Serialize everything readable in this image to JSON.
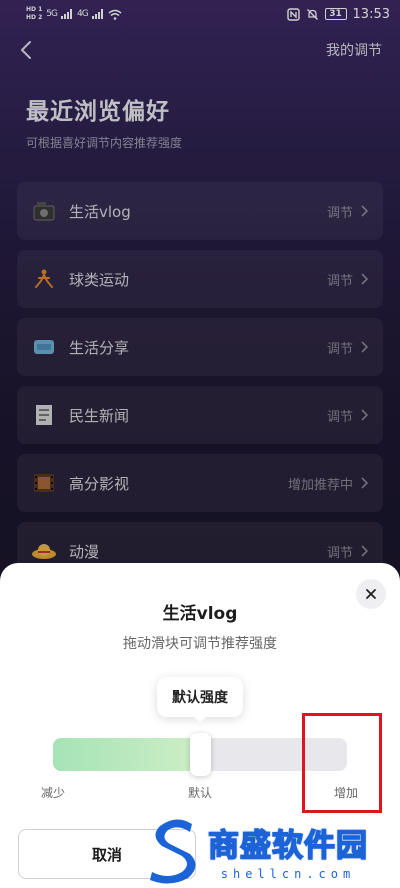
{
  "status_bar": {
    "hd1": "HD 1",
    "hd2": "HD 2",
    "signal1": "5G",
    "signal2": "4G",
    "battery": "31",
    "time": "13:53"
  },
  "nav": {
    "right_label": "我的调节"
  },
  "header": {
    "title": "最近浏览偏好",
    "subtitle": "可根据喜好调节内容推荐强度"
  },
  "preferences": [
    {
      "label": "生活vlog",
      "action": "调节",
      "icon": "camera-icon"
    },
    {
      "label": "球类运动",
      "action": "调节",
      "icon": "sports-icon"
    },
    {
      "label": "生活分享",
      "action": "调节",
      "icon": "sofa-icon"
    },
    {
      "label": "民生新闻",
      "action": "调节",
      "icon": "news-icon"
    },
    {
      "label": "高分影视",
      "action": "增加推荐中",
      "icon": "film-icon"
    },
    {
      "label": "动漫",
      "action": "调节",
      "icon": "hat-icon"
    }
  ],
  "sheet": {
    "title": "生活vlog",
    "subtitle": "拖动滑块可调节推荐强度",
    "tooltip": "默认强度",
    "scale_min": "减少",
    "scale_mid": "默认",
    "scale_max": "增加",
    "slider_level": 0.5,
    "cancel_label": "取消"
  },
  "watermark": {
    "chinese": "商盛软件园",
    "english": "shellcn.com"
  },
  "colors": {
    "accent_fill": "#a6e3b6",
    "highlight_box": "#e0141e",
    "watermark_blue": "#1d63d8"
  }
}
